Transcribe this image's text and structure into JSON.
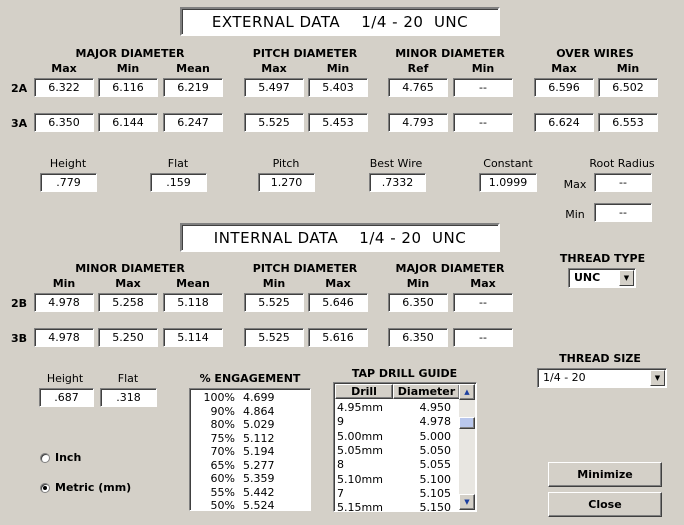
{
  "external_title": "EXTERNAL DATA    1/4 - 20  UNC",
  "internal_title": "INTERNAL DATA    1/4 - 20  UNC",
  "external": {
    "major_label": "MAJOR DIAMETER",
    "pitch_label": "PITCH DIAMETER",
    "minor_label": "MINOR DIAMETER",
    "over_wires_label": "OVER WIRES",
    "col_max": "Max",
    "col_min": "Min",
    "col_mean": "Mean",
    "col_ref": "Ref",
    "row_2a": "2A",
    "row_3a": "3A",
    "r2a": {
      "major_max": "6.322",
      "major_min": "6.116",
      "major_mean": "6.219",
      "pitch_max": "5.497",
      "pitch_min": "5.403",
      "minor_ref": "4.765",
      "minor_min": "--",
      "ow_max": "6.596",
      "ow_min": "6.502"
    },
    "r3a": {
      "major_max": "6.350",
      "major_min": "6.144",
      "major_mean": "6.247",
      "pitch_max": "5.525",
      "pitch_min": "5.453",
      "minor_ref": "4.793",
      "minor_min": "--",
      "ow_max": "6.624",
      "ow_min": "6.553"
    }
  },
  "ext_misc": {
    "height_label": "Height",
    "height": ".779",
    "flat_label": "Flat",
    "flat": ".159",
    "pitch_label": "Pitch",
    "pitch": "1.270",
    "bestwire_label": "Best Wire",
    "bestwire": ".7332",
    "constant_label": "Constant",
    "constant": "1.0999",
    "root_label": "Root Radius",
    "root_max_label": "Max",
    "root_max": "--",
    "root_min_label": "Min",
    "root_min": "--"
  },
  "internal": {
    "minor_label": "MINOR DIAMETER",
    "pitch_label": "PITCH DIAMETER",
    "major_label": "MAJOR DIAMETER",
    "col_min": "Min",
    "col_max": "Max",
    "col_mean": "Mean",
    "row_2b": "2B",
    "row_3b": "3B",
    "r2b": {
      "minor_min": "4.978",
      "minor_max": "5.258",
      "minor_mean": "5.118",
      "pitch_min": "5.525",
      "pitch_max": "5.646",
      "major_min": "6.350",
      "major_max": "--"
    },
    "r3b": {
      "minor_min": "4.978",
      "minor_max": "5.250",
      "minor_mean": "5.114",
      "pitch_min": "5.525",
      "pitch_max": "5.616",
      "major_min": "6.350",
      "major_max": "--"
    }
  },
  "int_misc": {
    "height_label": "Height",
    "height": ".687",
    "flat_label": "Flat",
    "flat": ".318"
  },
  "thread_type": {
    "label": "THREAD TYPE",
    "value": "UNC"
  },
  "thread_size": {
    "label": "THREAD SIZE",
    "value": "1/4 - 20"
  },
  "engagement": {
    "label": "% ENGAGEMENT",
    "rows": [
      {
        "pct": "100%",
        "val": "4.699"
      },
      {
        "pct": "90%",
        "val": "4.864"
      },
      {
        "pct": "80%",
        "val": "5.029"
      },
      {
        "pct": "75%",
        "val": "5.112"
      },
      {
        "pct": "70%",
        "val": "5.194"
      },
      {
        "pct": "65%",
        "val": "5.277"
      },
      {
        "pct": "60%",
        "val": "5.359"
      },
      {
        "pct": "55%",
        "val": "5.442"
      },
      {
        "pct": "50%",
        "val": "5.524"
      }
    ]
  },
  "tap_drill": {
    "label": "TAP DRILL GUIDE",
    "col_drill": "Drill",
    "col_diameter": "Diameter",
    "rows": [
      {
        "drill": "4.95mm",
        "dia": "4.950"
      },
      {
        "drill": "9",
        "dia": "4.978"
      },
      {
        "drill": "5.00mm",
        "dia": "5.000"
      },
      {
        "drill": "5.05mm",
        "dia": "5.050"
      },
      {
        "drill": "8",
        "dia": "5.055"
      },
      {
        "drill": "5.10mm",
        "dia": "5.100"
      },
      {
        "drill": "7",
        "dia": "5.105"
      },
      {
        "drill": "5.15mm",
        "dia": "5.150"
      }
    ]
  },
  "units": {
    "inch": "Inch",
    "metric": "Metric (mm)",
    "selected": "metric"
  },
  "buttons": {
    "minimize": "Minimize",
    "close": "Close"
  }
}
